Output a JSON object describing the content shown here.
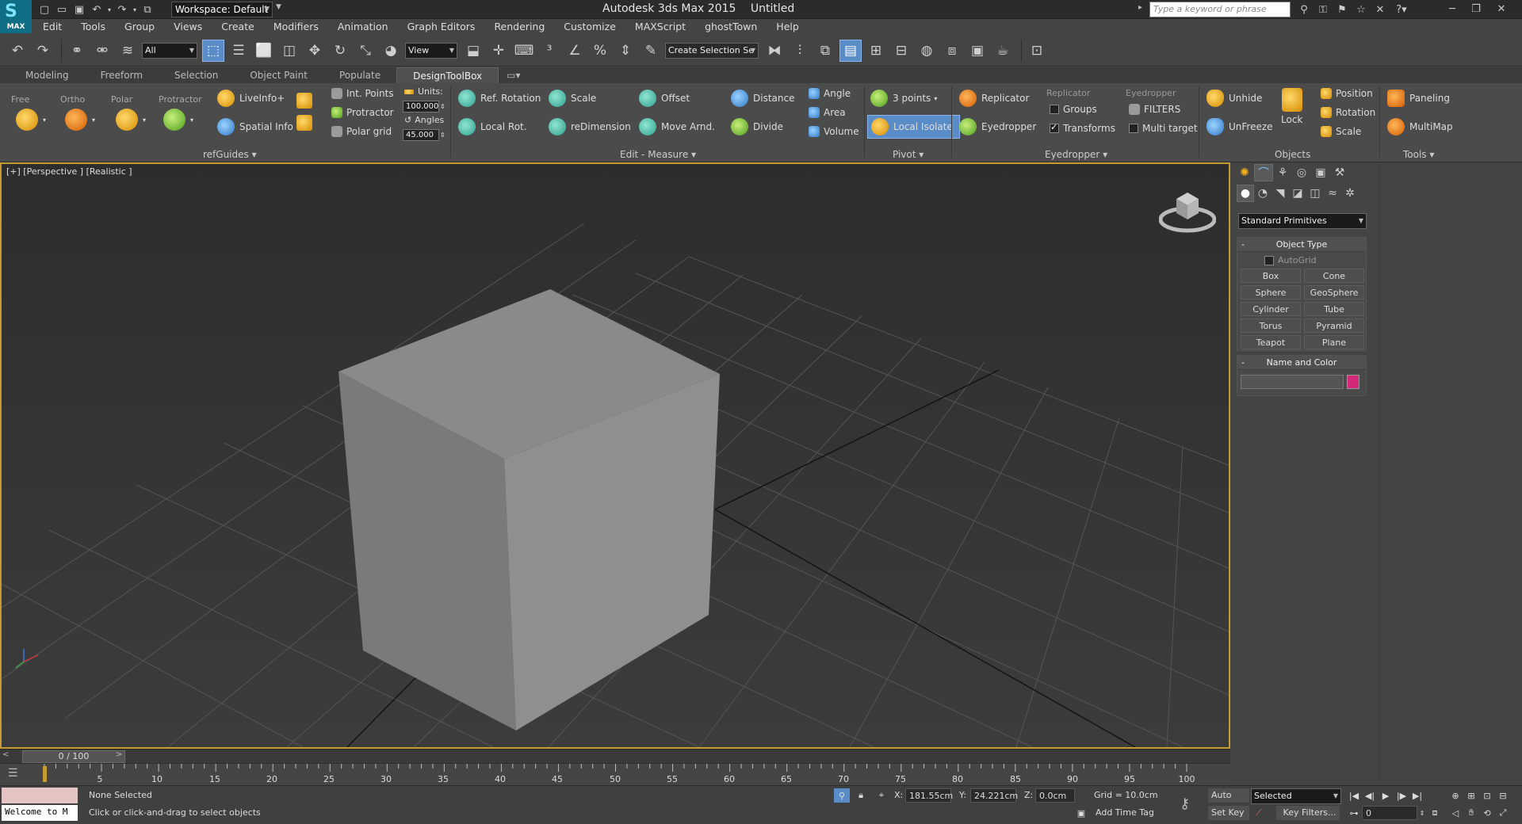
{
  "titlebar": {
    "app_title": "Autodesk 3ds Max  2015",
    "file_name": "Untitled",
    "workspace_label": "Workspace: Default",
    "search_placeholder": "Type a keyword or phrase",
    "logo_text": "MAX",
    "quick_access_icons": [
      "new-file-icon",
      "open-file-icon",
      "save-icon",
      "undo-icon",
      "redo-icon",
      "project-folder-icon"
    ],
    "help_icons": [
      "binoculars-icon",
      "key-tool-icon",
      "communication-icon",
      "favorites-star-icon",
      "close-x-icon",
      "help-icon"
    ]
  },
  "menubar": {
    "items": [
      "Edit",
      "Tools",
      "Group",
      "Views",
      "Create",
      "Modifiers",
      "Animation",
      "Graph Editors",
      "Rendering",
      "Customize",
      "MAXScript",
      "ghostTown",
      "Help"
    ]
  },
  "main_toolbar": {
    "selection_filter": "All",
    "ref_coord": "View",
    "named_selection": "Create Selection Se"
  },
  "ribbon_tabs": {
    "tabs": [
      "Modeling",
      "Freeform",
      "Selection",
      "Object Paint",
      "Populate",
      "DesignToolBox"
    ],
    "active": "DesignToolBox"
  },
  "ribbon": {
    "refguides": {
      "title": "refGuides",
      "snap_labels": [
        "Free",
        "Ortho",
        "Polar",
        "Protractor"
      ],
      "liveinfo": "LiveInfo+",
      "spatial_info": "Spatial Info",
      "int_points": "Int. Points",
      "protractor": "Protractor",
      "polar_grid": "Polar grid",
      "units_label": "Units:",
      "units_value": "100.000",
      "angles_label": "Angles",
      "angles_value": "45.000"
    },
    "edit_measure": {
      "title": "Edit - Measure",
      "ref_rotation": "Ref. Rotation",
      "local_rot": "Local Rot.",
      "scale": "Scale",
      "redimension": "reDimension",
      "offset": "Offset",
      "move_arnd": "Move Arnd.",
      "distance": "Distance",
      "divide": "Divide",
      "angle": "Angle",
      "area": "Area",
      "volume": "Volume"
    },
    "pivot": {
      "title": "Pivot",
      "three_points": "3 points",
      "local_isolate": "Local Isolate"
    },
    "eyedropper": {
      "title": "Eyedropper",
      "replicator_btn": "Replicator",
      "eyedropper_btn": "Eyedropper",
      "replicator_hdr": "Replicator",
      "groups": "Groups",
      "transforms": "Transforms",
      "eyedropper_hdr": "Eyedropper",
      "filters": "FILTERS",
      "multi_target": "Multi target"
    },
    "objects": {
      "title": "Objects",
      "unhide": "Unhide",
      "unfreeze": "UnFreeze",
      "lock": "Lock",
      "position": "Position",
      "rotation": "Rotation",
      "scale": "Scale"
    },
    "tools": {
      "title": "Tools",
      "paneling": "Paneling",
      "multimap": "MultiMap"
    }
  },
  "viewport": {
    "label": "[+] [Perspective ] [Realistic ]"
  },
  "command_panel": {
    "category": "Standard Primitives",
    "object_type_title": "Object Type",
    "autogrid": "AutoGrid",
    "primitives": [
      "Box",
      "Cone",
      "Sphere",
      "GeoSphere",
      "Cylinder",
      "Tube",
      "Torus",
      "Pyramid",
      "Teapot",
      "Plane"
    ],
    "name_color_title": "Name and Color",
    "object_color": "#d4287a"
  },
  "timeline": {
    "frame_display": "0 / 100",
    "ticks": [
      "5",
      "10",
      "15",
      "20",
      "25",
      "30",
      "35",
      "40",
      "45",
      "50",
      "55",
      "60",
      "65",
      "70",
      "75",
      "80",
      "85",
      "90",
      "95",
      "100"
    ]
  },
  "statusbar": {
    "maxscript_listener": "Welcome to M",
    "selection_status": "None Selected",
    "prompt": "Click or click-and-drag to select objects",
    "x_label": "X:",
    "x_value": "181.55cm",
    "y_label": "Y:",
    "y_value": "24.221cm",
    "z_label": "Z:",
    "z_value": "0.0cm",
    "grid": "Grid = 10.0cm",
    "add_time_tag": "Add Time Tag",
    "auto_key": "Auto Key",
    "set_key": "Set Key",
    "key_mode": "Selected",
    "key_filters": "Key Filters...",
    "current_frame": "0"
  },
  "colors": {
    "accent_blue": "#5a8cc8",
    "viewport_border": "#c59c34",
    "cube_top": "#8a8a8a",
    "cube_left": "#7a7a7a",
    "cube_right": "#8f8f8f"
  }
}
